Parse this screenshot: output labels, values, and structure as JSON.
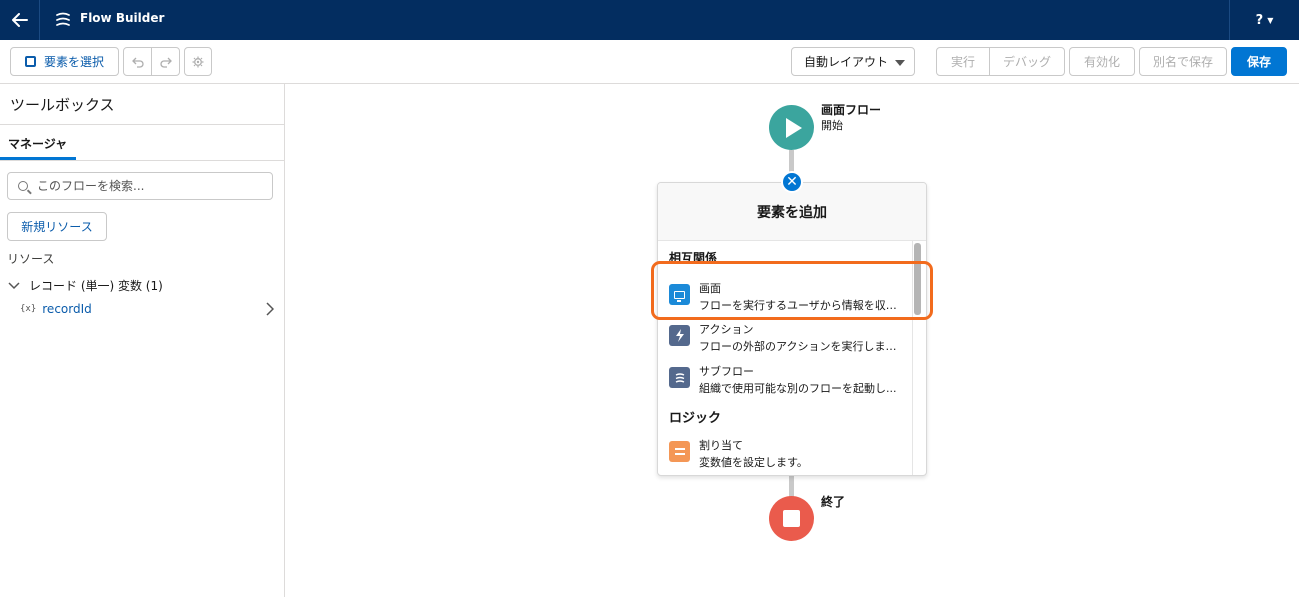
{
  "header": {
    "title": "Flow Builder",
    "help": "?"
  },
  "toolbar": {
    "select_elements": "要素を選択",
    "layout_select": "自動レイアウト",
    "run": "実行",
    "debug": "デバッグ",
    "activate": "有効化",
    "save_as": "別名で保存",
    "save": "保存"
  },
  "sidebar": {
    "title": "ツールボックス",
    "tab": "マネージャ",
    "search_placeholder": "このフローを検索...",
    "new_resource": "新規リソース",
    "resources_label": "リソース",
    "group_label": "レコード (単一) 変数 (1)",
    "item_icon": "{x}",
    "item_name": "recordId"
  },
  "canvas": {
    "start_title": "画面フロー",
    "start_sub": "開始",
    "end_label": "終了",
    "popup": {
      "title": "要素を追加",
      "section_interaction": "相互関係",
      "section_logic": "ロジック",
      "items": [
        {
          "label": "画面",
          "desc": "フローを実行するユーザから情報を収集..."
        },
        {
          "label": "アクション",
          "desc": "フローの外部のアクションを実行します..."
        },
        {
          "label": "サブフロー",
          "desc": "組織で使用可能な別のフローを起動し..."
        },
        {
          "label": "割り当て",
          "desc": "変数値を設定します。"
        }
      ]
    }
  },
  "colors": {
    "header_bg": "#032d60",
    "brand": "#0176d3",
    "start": "#3ba59e",
    "end": "#ea5b4c",
    "highlight": "#f26b1d"
  }
}
